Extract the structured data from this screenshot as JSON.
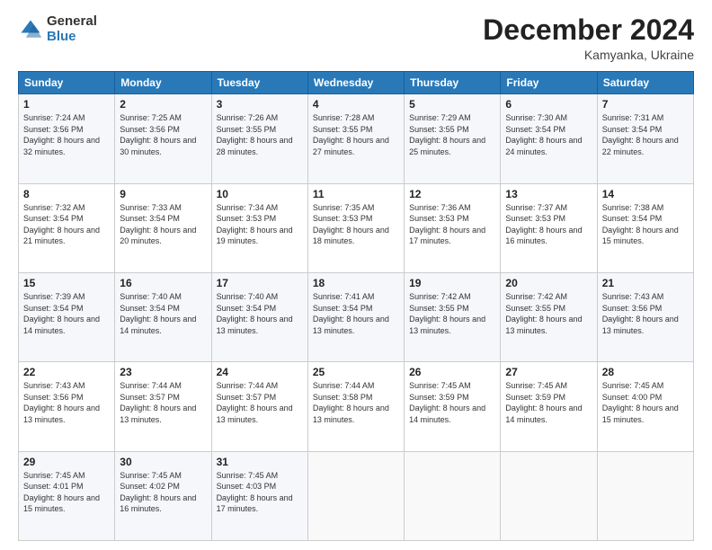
{
  "header": {
    "logo": {
      "general": "General",
      "blue": "Blue"
    },
    "title": "December 2024",
    "subtitle": "Kamyanka, Ukraine"
  },
  "calendar": {
    "days_of_week": [
      "Sunday",
      "Monday",
      "Tuesday",
      "Wednesday",
      "Thursday",
      "Friday",
      "Saturday"
    ],
    "weeks": [
      [
        {
          "day": "1",
          "sunrise": "7:24 AM",
          "sunset": "3:56 PM",
          "daylight": "8 hours and 32 minutes."
        },
        {
          "day": "2",
          "sunrise": "7:25 AM",
          "sunset": "3:56 PM",
          "daylight": "8 hours and 30 minutes."
        },
        {
          "day": "3",
          "sunrise": "7:26 AM",
          "sunset": "3:55 PM",
          "daylight": "8 hours and 28 minutes."
        },
        {
          "day": "4",
          "sunrise": "7:28 AM",
          "sunset": "3:55 PM",
          "daylight": "8 hours and 27 minutes."
        },
        {
          "day": "5",
          "sunrise": "7:29 AM",
          "sunset": "3:55 PM",
          "daylight": "8 hours and 25 minutes."
        },
        {
          "day": "6",
          "sunrise": "7:30 AM",
          "sunset": "3:54 PM",
          "daylight": "8 hours and 24 minutes."
        },
        {
          "day": "7",
          "sunrise": "7:31 AM",
          "sunset": "3:54 PM",
          "daylight": "8 hours and 22 minutes."
        }
      ],
      [
        {
          "day": "8",
          "sunrise": "7:32 AM",
          "sunset": "3:54 PM",
          "daylight": "8 hours and 21 minutes."
        },
        {
          "day": "9",
          "sunrise": "7:33 AM",
          "sunset": "3:54 PM",
          "daylight": "8 hours and 20 minutes."
        },
        {
          "day": "10",
          "sunrise": "7:34 AM",
          "sunset": "3:53 PM",
          "daylight": "8 hours and 19 minutes."
        },
        {
          "day": "11",
          "sunrise": "7:35 AM",
          "sunset": "3:53 PM",
          "daylight": "8 hours and 18 minutes."
        },
        {
          "day": "12",
          "sunrise": "7:36 AM",
          "sunset": "3:53 PM",
          "daylight": "8 hours and 17 minutes."
        },
        {
          "day": "13",
          "sunrise": "7:37 AM",
          "sunset": "3:53 PM",
          "daylight": "8 hours and 16 minutes."
        },
        {
          "day": "14",
          "sunrise": "7:38 AM",
          "sunset": "3:54 PM",
          "daylight": "8 hours and 15 minutes."
        }
      ],
      [
        {
          "day": "15",
          "sunrise": "7:39 AM",
          "sunset": "3:54 PM",
          "daylight": "8 hours and 14 minutes."
        },
        {
          "day": "16",
          "sunrise": "7:40 AM",
          "sunset": "3:54 PM",
          "daylight": "8 hours and 14 minutes."
        },
        {
          "day": "17",
          "sunrise": "7:40 AM",
          "sunset": "3:54 PM",
          "daylight": "8 hours and 13 minutes."
        },
        {
          "day": "18",
          "sunrise": "7:41 AM",
          "sunset": "3:54 PM",
          "daylight": "8 hours and 13 minutes."
        },
        {
          "day": "19",
          "sunrise": "7:42 AM",
          "sunset": "3:55 PM",
          "daylight": "8 hours and 13 minutes."
        },
        {
          "day": "20",
          "sunrise": "7:42 AM",
          "sunset": "3:55 PM",
          "daylight": "8 hours and 13 minutes."
        },
        {
          "day": "21",
          "sunrise": "7:43 AM",
          "sunset": "3:56 PM",
          "daylight": "8 hours and 13 minutes."
        }
      ],
      [
        {
          "day": "22",
          "sunrise": "7:43 AM",
          "sunset": "3:56 PM",
          "daylight": "8 hours and 13 minutes."
        },
        {
          "day": "23",
          "sunrise": "7:44 AM",
          "sunset": "3:57 PM",
          "daylight": "8 hours and 13 minutes."
        },
        {
          "day": "24",
          "sunrise": "7:44 AM",
          "sunset": "3:57 PM",
          "daylight": "8 hours and 13 minutes."
        },
        {
          "day": "25",
          "sunrise": "7:44 AM",
          "sunset": "3:58 PM",
          "daylight": "8 hours and 13 minutes."
        },
        {
          "day": "26",
          "sunrise": "7:45 AM",
          "sunset": "3:59 PM",
          "daylight": "8 hours and 14 minutes."
        },
        {
          "day": "27",
          "sunrise": "7:45 AM",
          "sunset": "3:59 PM",
          "daylight": "8 hours and 14 minutes."
        },
        {
          "day": "28",
          "sunrise": "7:45 AM",
          "sunset": "4:00 PM",
          "daylight": "8 hours and 15 minutes."
        }
      ],
      [
        {
          "day": "29",
          "sunrise": "7:45 AM",
          "sunset": "4:01 PM",
          "daylight": "8 hours and 15 minutes."
        },
        {
          "day": "30",
          "sunrise": "7:45 AM",
          "sunset": "4:02 PM",
          "daylight": "8 hours and 16 minutes."
        },
        {
          "day": "31",
          "sunrise": "7:45 AM",
          "sunset": "4:03 PM",
          "daylight": "8 hours and 17 minutes."
        },
        null,
        null,
        null,
        null
      ]
    ],
    "labels": {
      "sunrise": "Sunrise:",
      "sunset": "Sunset:",
      "daylight": "Daylight:"
    }
  }
}
